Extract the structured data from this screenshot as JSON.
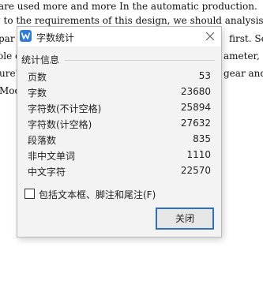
{
  "document": {
    "lines": [
      "are used more and more In the automatic production.",
      "g to the requirements of this design, we should analysis the character",
      "par",
      "first. Secon",
      "ole c",
      "ameter, and",
      "ure\".",
      "gear and the",
      "Mod"
    ]
  },
  "dialog": {
    "title": "字数统计",
    "group_label": "统计信息",
    "stats": [
      {
        "label": "页数",
        "value": "53"
      },
      {
        "label": "字数",
        "value": "23680"
      },
      {
        "label": "字符数(不计空格)",
        "value": "25894"
      },
      {
        "label": "字符数(计空格)",
        "value": "27632"
      },
      {
        "label": "段落数",
        "value": "835"
      },
      {
        "label": "非中文单词",
        "value": "1110"
      },
      {
        "label": "中文字符",
        "value": "22570"
      }
    ],
    "checkbox_label": "包括文本框、脚注和尾注(F)",
    "checkbox_checked": false,
    "close_button_label": "关闭",
    "icons": {
      "app": "wps-writer-icon",
      "close": "close-icon"
    },
    "colors": {
      "accent": "#2e6fc2",
      "app_icon": "#2f7bd6"
    }
  }
}
